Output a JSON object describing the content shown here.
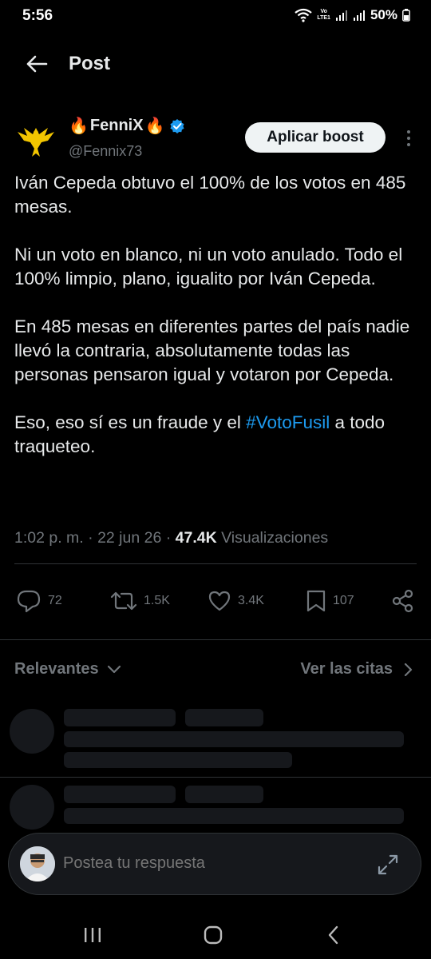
{
  "status_bar": {
    "time": "5:56",
    "battery": "50%",
    "volte_label": "Vo\nLTE1"
  },
  "header": {
    "title": "Post"
  },
  "post": {
    "author_name": "FenniX",
    "author_emoji_left": "🔥",
    "author_emoji_right": "🔥",
    "handle": "@Fennix73",
    "boost_label": "Aplicar boost",
    "paragraphs": [
      "Iván Cepeda obtuvo el 100% de los votos en 485 mesas.",
      "Ni un voto en blanco, ni un voto anulado. Todo el 100% limpio, plano, igualito por Iván Cepeda.",
      "En 485 mesas en diferentes partes del país nadie llevó la contraria, absolutamente todas las personas pensaron igual y votaron por Cepeda."
    ],
    "last_paragraph_before": "Eso, eso sí es un fraude y el ",
    "hashtag": "#VotoFusil",
    "last_paragraph_after": " a todo traqueteo.",
    "time": "1:02 p. m.",
    "date": "22 jun 26",
    "views_count": "47.4K",
    "views_label": "Visualizaciones",
    "accent_color": "#1d9bf0"
  },
  "actions": {
    "replies": "72",
    "reposts": "1.5K",
    "likes": "3.4K",
    "bookmarks": "107"
  },
  "replies_section": {
    "sort_label": "Relevantes",
    "quotes_label": "Ver las citas"
  },
  "reply_box": {
    "placeholder": "Postea tu respuesta"
  }
}
